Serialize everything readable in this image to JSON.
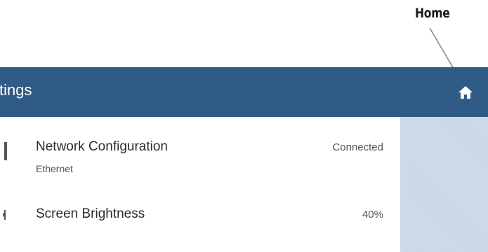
{
  "callout": {
    "label": "Home"
  },
  "app_bar": {
    "title": "tings",
    "home_icon": "home-icon",
    "color": "#315b87"
  },
  "settings": [
    {
      "title": "Network Configuration",
      "subtitle": "Ethernet",
      "value": "Connected",
      "icon": "network-icon"
    },
    {
      "title": "Screen Brightness",
      "value": "40%",
      "icon": "brightness-icon"
    }
  ],
  "side_pane": {
    "color": "#c9d6e6"
  }
}
